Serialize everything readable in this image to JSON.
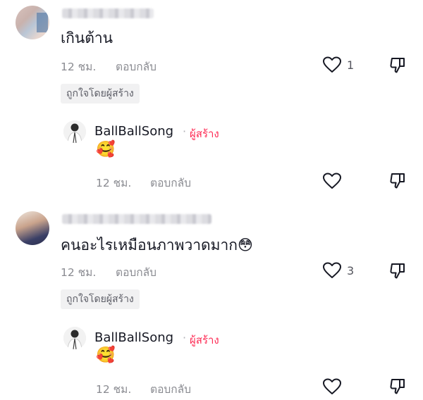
{
  "comments": [
    {
      "text": "เกินต้าน",
      "time": "12 ชม.",
      "reply_label": "ตอบกลับ",
      "like_count": "1",
      "liked_by_creator": "ถูกใจโดยผู้สร้าง",
      "reply": {
        "username": "BallBallSong",
        "separator": "·",
        "creator_label": "ผู้สร้าง",
        "text": "🥰",
        "time": "12 ชม.",
        "reply_label": "ตอบกลับ"
      }
    },
    {
      "text": "คนอะไรเหมือนภาพวาดมาก😳",
      "time": "12 ชม.",
      "reply_label": "ตอบกลับ",
      "like_count": "3",
      "liked_by_creator": "ถูกใจโดยผู้สร้าง",
      "reply": {
        "username": "BallBallSong",
        "separator": "·",
        "creator_label": "ผู้สร้าง",
        "text": "🥰",
        "time": "12 ชม.",
        "reply_label": "ตอบกลับ"
      }
    }
  ],
  "colors": {
    "creator_accent": "#fe2c55",
    "meta_gray": "#8a8b91",
    "text_dark": "#161823"
  },
  "icons": [
    "heart-icon",
    "dislike-icon"
  ]
}
